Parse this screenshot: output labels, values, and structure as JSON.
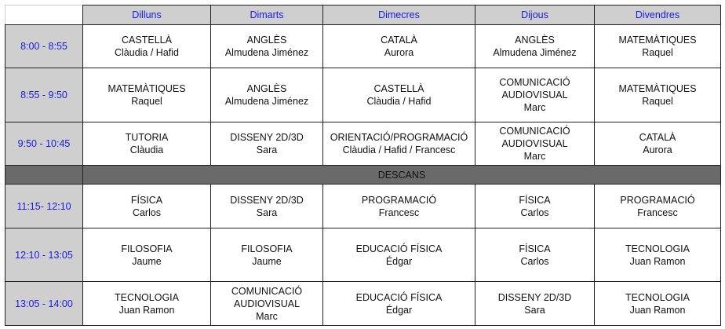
{
  "days": [
    "Dilluns",
    "Dimarts",
    "Dimecres",
    "Dijous",
    "Divendres"
  ],
  "break_label": "DESCANS",
  "rows": [
    {
      "time": "8:00 - 8:55",
      "cells": [
        [
          "CASTELLÀ",
          "Clàudia / Hafid"
        ],
        [
          "ANGLÈS",
          "Almudena Jiménez"
        ],
        [
          "CATALÀ",
          "Aurora"
        ],
        [
          "ANGLÈS",
          "Almudena Jiménez"
        ],
        [
          "MATEMÀTIQUES",
          "Raquel"
        ]
      ]
    },
    {
      "time": "8:55 - 9:50",
      "cells": [
        [
          "MATEMÀTIQUES",
          "Raquel"
        ],
        [
          "ANGLÈS",
          "Almudena Jiménez"
        ],
        [
          "CASTELLÀ",
          "Clàudia / Hafid"
        ],
        [
          "COMUNICACIÓ",
          "AUDIOVISUAL",
          "Marc"
        ],
        [
          "MATEMÀTIQUES",
          "Raquel"
        ]
      ]
    },
    {
      "time": "9:50 - 10:45",
      "cells": [
        [
          "TUTORIA",
          "Clàudia"
        ],
        [
          "DISSENY 2D/3D",
          "Sara"
        ],
        [
          "ORIENTACIÓ/PROGRAMACIÓ",
          "Clàudia / Hafid / Francesc"
        ],
        [
          "COMUNICACIÓ",
          "AUDIOVISUAL",
          "Marc"
        ],
        [
          "CATALÀ",
          "Aurora"
        ]
      ]
    },
    {
      "time": "11:15- 12:10",
      "cells": [
        [
          "FÍSICA",
          "Carlos"
        ],
        [
          "DISSENY 2D/3D",
          "Sara"
        ],
        [
          "PROGRAMACIÓ",
          "Francesc"
        ],
        [
          "FÍSICA",
          "Carlos"
        ],
        [
          "PROGRAMACIÓ",
          "Francesc"
        ]
      ]
    },
    {
      "time": "12:10 - 13:05",
      "cells": [
        [
          "FILOSOFIA",
          "Jaume"
        ],
        [
          "FILOSOFIA",
          "Jaume"
        ],
        [
          "EDUCACIÓ FÍSICA",
          "Édgar"
        ],
        [
          "FÍSICA",
          "Carlos"
        ],
        [
          "TECNOLOGIA",
          "Juan Ramon"
        ]
      ]
    },
    {
      "time": "13:05 - 14:00",
      "cells": [
        [
          "TECNOLOGIA",
          "Juan Ramon"
        ],
        [
          "COMUNICACIÓ",
          "AUDIOVISUAL",
          "Marc"
        ],
        [
          "EDUCACIÓ FÍSICA",
          "Édgar"
        ],
        [
          "DISSENY 2D/3D",
          "Sara"
        ],
        [
          "TECNOLOGIA",
          "Juan Ramon"
        ]
      ]
    }
  ]
}
